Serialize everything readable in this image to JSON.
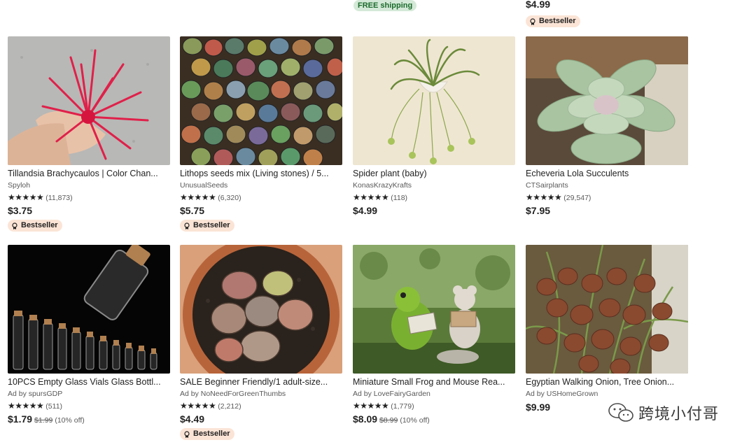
{
  "top": {
    "free_shipping": "FREE shipping",
    "price": "$4.99",
    "badge": "Bestseller"
  },
  "listings": [
    {
      "title": "Tillandsia Brachycaulos | Color Chan...",
      "shop": "Spyloh",
      "stars": "★★★★★",
      "reviews": "(11,873)",
      "price": "$3.75",
      "badge": "Bestseller"
    },
    {
      "title": "Lithops seeds mix (Living stones) / 5...",
      "shop": "UnusualSeeds",
      "stars": "★★★★★",
      "reviews": "(6,320)",
      "price": "$5.75",
      "badge": "Bestseller"
    },
    {
      "title": "Spider plant (baby)",
      "shop": "KonasKrazyKrafts",
      "stars": "★★★★★",
      "reviews": "(118)",
      "price": "$4.99"
    },
    {
      "title": "Echeveria Lola Succulents",
      "shop": "CTSairplants",
      "stars": "★★★★★",
      "reviews": "(29,547)",
      "price": "$7.95"
    },
    {
      "title": "10PCS Empty Glass Vials Glass Bottl...",
      "shop": "Ad by spursGDP",
      "stars": "★★★★★",
      "reviews": "(511)",
      "price": "$1.79",
      "original_price": "$1.99",
      "discount": "(10% off)"
    },
    {
      "title": "SALE Beginner Friendly/1 adult-size...",
      "shop": "Ad by NoNeedForGreenThumbs",
      "stars": "★★★★★",
      "reviews": "(2,212)",
      "price": "$4.49",
      "badge": "Bestseller"
    },
    {
      "title": "Miniature Small Frog and Mouse Rea...",
      "shop": "Ad by LoveFairyGarden",
      "stars": "★★★★★",
      "reviews": "(1,779)",
      "price": "$8.09",
      "original_price": "$8.99",
      "discount": "(10% off)"
    },
    {
      "title": "Egyptian Walking Onion, Tree Onion...",
      "shop": "Ad by USHomeGrown",
      "stars": "★★★★★",
      "reviews": "",
      "price": "$9.99"
    }
  ],
  "watermark": {
    "text": "跨境小付哥",
    "icon": "wechat-icon"
  },
  "colors": {
    "bestseller_bg": "#fbe4d6",
    "free_shipping_bg": "#d4e9d7",
    "free_shipping_text": "#1a6b2b"
  }
}
